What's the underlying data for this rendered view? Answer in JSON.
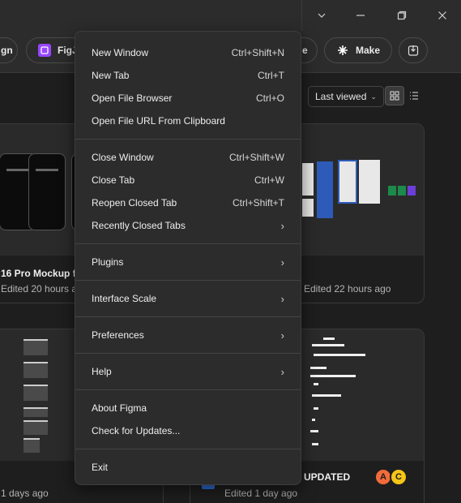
{
  "toolbar": {
    "pill_partial_left": "gn",
    "pill_figjam": "FigJ",
    "pill_partial_mid": "e",
    "make_label": "Make"
  },
  "files": {
    "sort_label": "Last viewed",
    "cards": [
      {
        "title": "16 Pro Mockup for",
        "subtitle": "Edited 20 hours a"
      },
      {
        "title": "",
        "subtitle": "Edited 22 hours ago"
      },
      {
        "title": "",
        "subtitle": "1 days ago"
      },
      {
        "title": "UPDATED",
        "subtitle": "Edited 1 day ago",
        "avatars": [
          "A",
          "C"
        ]
      }
    ]
  },
  "menu": {
    "items": [
      {
        "label": "New Window",
        "shortcut": "Ctrl+Shift+N"
      },
      {
        "label": "New Tab",
        "shortcut": "Ctrl+T"
      },
      {
        "label": "Open File Browser",
        "shortcut": "Ctrl+O"
      },
      {
        "label": "Open File URL From Clipboard",
        "shortcut": ""
      },
      {
        "label": "Close Window",
        "shortcut": "Ctrl+Shift+W"
      },
      {
        "label": "Close Tab",
        "shortcut": "Ctrl+W"
      },
      {
        "label": "Reopen Closed Tab",
        "shortcut": "Ctrl+Shift+T"
      },
      {
        "label": "Recently Closed Tabs",
        "submenu": true
      },
      {
        "label": "Plugins",
        "submenu": true
      },
      {
        "label": "Interface Scale",
        "submenu": true
      },
      {
        "label": "Preferences",
        "submenu": true
      },
      {
        "label": "Help",
        "submenu": true
      },
      {
        "label": "About Figma",
        "shortcut": ""
      },
      {
        "label": "Check for Updates...",
        "shortcut": ""
      },
      {
        "label": "Exit",
        "shortcut": ""
      }
    ],
    "submenu_glyph": "›"
  },
  "colors": {
    "figjam_accent": "#9747ff",
    "avatar_a": "#f26b3a",
    "avatar_c": "#f5c518"
  }
}
